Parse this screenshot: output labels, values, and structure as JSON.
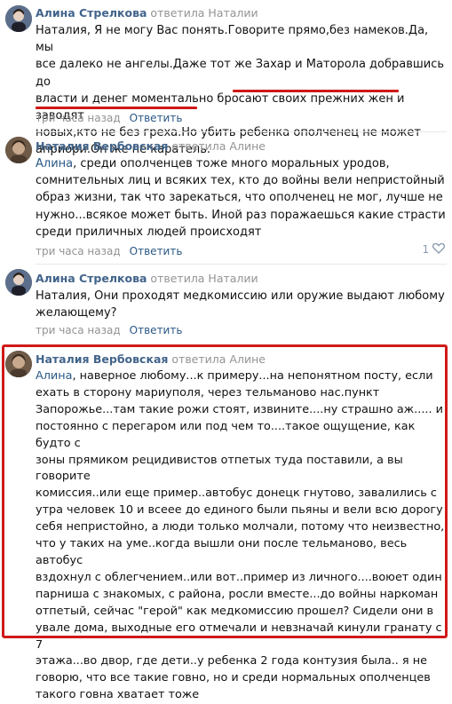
{
  "comments": [
    {
      "author": "Алина Стрелкова",
      "replied": "ответила Наталии",
      "addressee": "",
      "lines": [
        "Наталия, Я не могу Вас понять.Говорите прямо,без намеков.Да, мы",
        "все далеко не ангелы.Даже тот же Захар и Маторола добравшись до",
        "власти и денег моментально бросают своих прежних жен и заводят",
        "новых,кто не без греха.Но убить ребенка ополченец не может",
        "априори.Он же не каратель."
      ],
      "time": "три часа назад",
      "reply": "Ответить"
    },
    {
      "author": "Наталия Вербовская",
      "replied": "ответила Алине",
      "addressee": "Алина",
      "lines": [
        ", среди ополченцев тоже много моральных уродов,",
        "сомнительных лиц и всяких тех, кто до войны вели непристойный",
        "образ жизни, так что зарекаться, что ополченец не мог, лучше не",
        "нужно...всякое может быть. Иной раз поражаешься какие страсти",
        "среди приличных людей происходят"
      ],
      "time": "три часа назад",
      "reply": "Ответить",
      "likes": "1"
    },
    {
      "author": "Алина Стрелкова",
      "replied": "ответила Наталии",
      "addressee": "",
      "lines": [
        "Наталия, Они проходят медкомиссию или оружие выдают любому",
        "желающему?"
      ],
      "time": "три часа назад",
      "reply": "Ответить"
    },
    {
      "author": "Наталия Вербовская",
      "replied": "ответила Алине",
      "addressee": "Алина",
      "lines": [
        ", наверное любому...к примеру...на непонятном посту, если",
        "ехать в сторону мариуполя, через тельманово нас.пункт",
        "Запорожье...там такие рожи стоят, извините....ну страшно аж..... и",
        "постоянно с перегаром или под чем то....такое ощущение, как будто с",
        "зоны прямиком рецидивистов отпетых туда поставили, а вы говорите",
        "комиссия..или еще пример..автобус донецк гнутово, завалились с",
        "утра человек 10 и всеее до единого были пьяны и вели всю дорогу",
        "себя непристойно, а люди только молчали, потому что неизвестно,",
        "что у таких на уме..когда вышли они после тельманово, весь автобус",
        "вздохнул с облегчением..или вот..пример из личного....воюет один",
        "парниша с знакомых, с района, росли вместе...до войны наркоман",
        "отпетый, сейчас \"герой\" как медкомиссию прошел? Сидели они в",
        "увале дома, выходные его отмечали и невзначай кинули гранату с 7",
        "этажа...во двор, где дети..у ребенка 2 года контузия была.. я не",
        "говорю, что все такие говно, но и среди нормальных ополченцев",
        "такого говна хватает тоже"
      ]
    }
  ]
}
